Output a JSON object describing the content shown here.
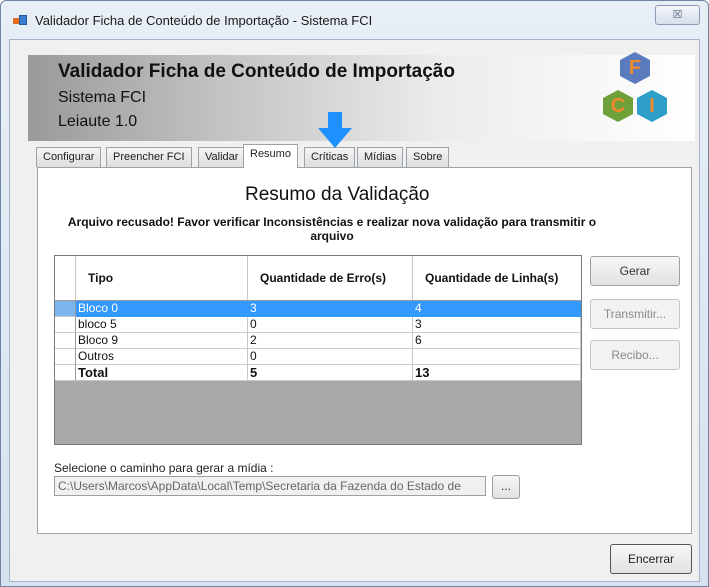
{
  "window": {
    "title": "Validador Ficha de Conteúdo de Importação - Sistema FCI",
    "close_glyph": "☒"
  },
  "header": {
    "title": "Validador Ficha de Conteúdo de Importação",
    "subtitle": "Sistema FCI",
    "version": "Leiaute 1.0"
  },
  "logo": {
    "letters": [
      "F",
      "C",
      "I"
    ]
  },
  "tabs": [
    {
      "label": "Configurar",
      "active": false
    },
    {
      "label": "Preencher FCI",
      "active": false
    },
    {
      "label": "Validar",
      "active": false
    },
    {
      "label": "Resumo",
      "active": true
    },
    {
      "label": "Críticas",
      "active": false
    },
    {
      "label": "Mídias",
      "active": false
    },
    {
      "label": "Sobre",
      "active": false
    }
  ],
  "resumo": {
    "title": "Resumo da Validação",
    "message": "Arquivo recusado! Favor verificar Inconsistências e realizar nova validação para transmitir o arquivo"
  },
  "grid": {
    "columns": [
      "Tipo",
      "Quantidade de Erro(s)",
      "Quantidade de Linha(s)"
    ],
    "rows": [
      {
        "tipo": "Bloco 0",
        "erros": "3",
        "linhas": "4",
        "selected": true
      },
      {
        "tipo": "bloco 5",
        "erros": "0",
        "linhas": "3"
      },
      {
        "tipo": "Bloco 9",
        "erros": "2",
        "linhas": "6"
      },
      {
        "tipo": "Outros",
        "erros": "0",
        "linhas": ""
      },
      {
        "tipo": "Total",
        "erros": "5",
        "linhas": "13",
        "bold": true
      }
    ]
  },
  "buttons": {
    "gerar": "Gerar",
    "transmitir": "Transmitir...",
    "recibo": "Recibo...",
    "encerrar": "Encerrar",
    "browse": "..."
  },
  "media": {
    "label": "Selecione o caminho para gerar a mídia :",
    "path": "C:\\Users\\Marcos\\AppData\\Local\\Temp\\Secretaria da Fazenda do Estado de"
  },
  "colors": {
    "selection": "#3399ff",
    "arrow": "#1e90ff",
    "logo_orange": "#f08a2a"
  },
  "icons": [
    "app-icon",
    "close-icon",
    "down-arrow-icon"
  ]
}
